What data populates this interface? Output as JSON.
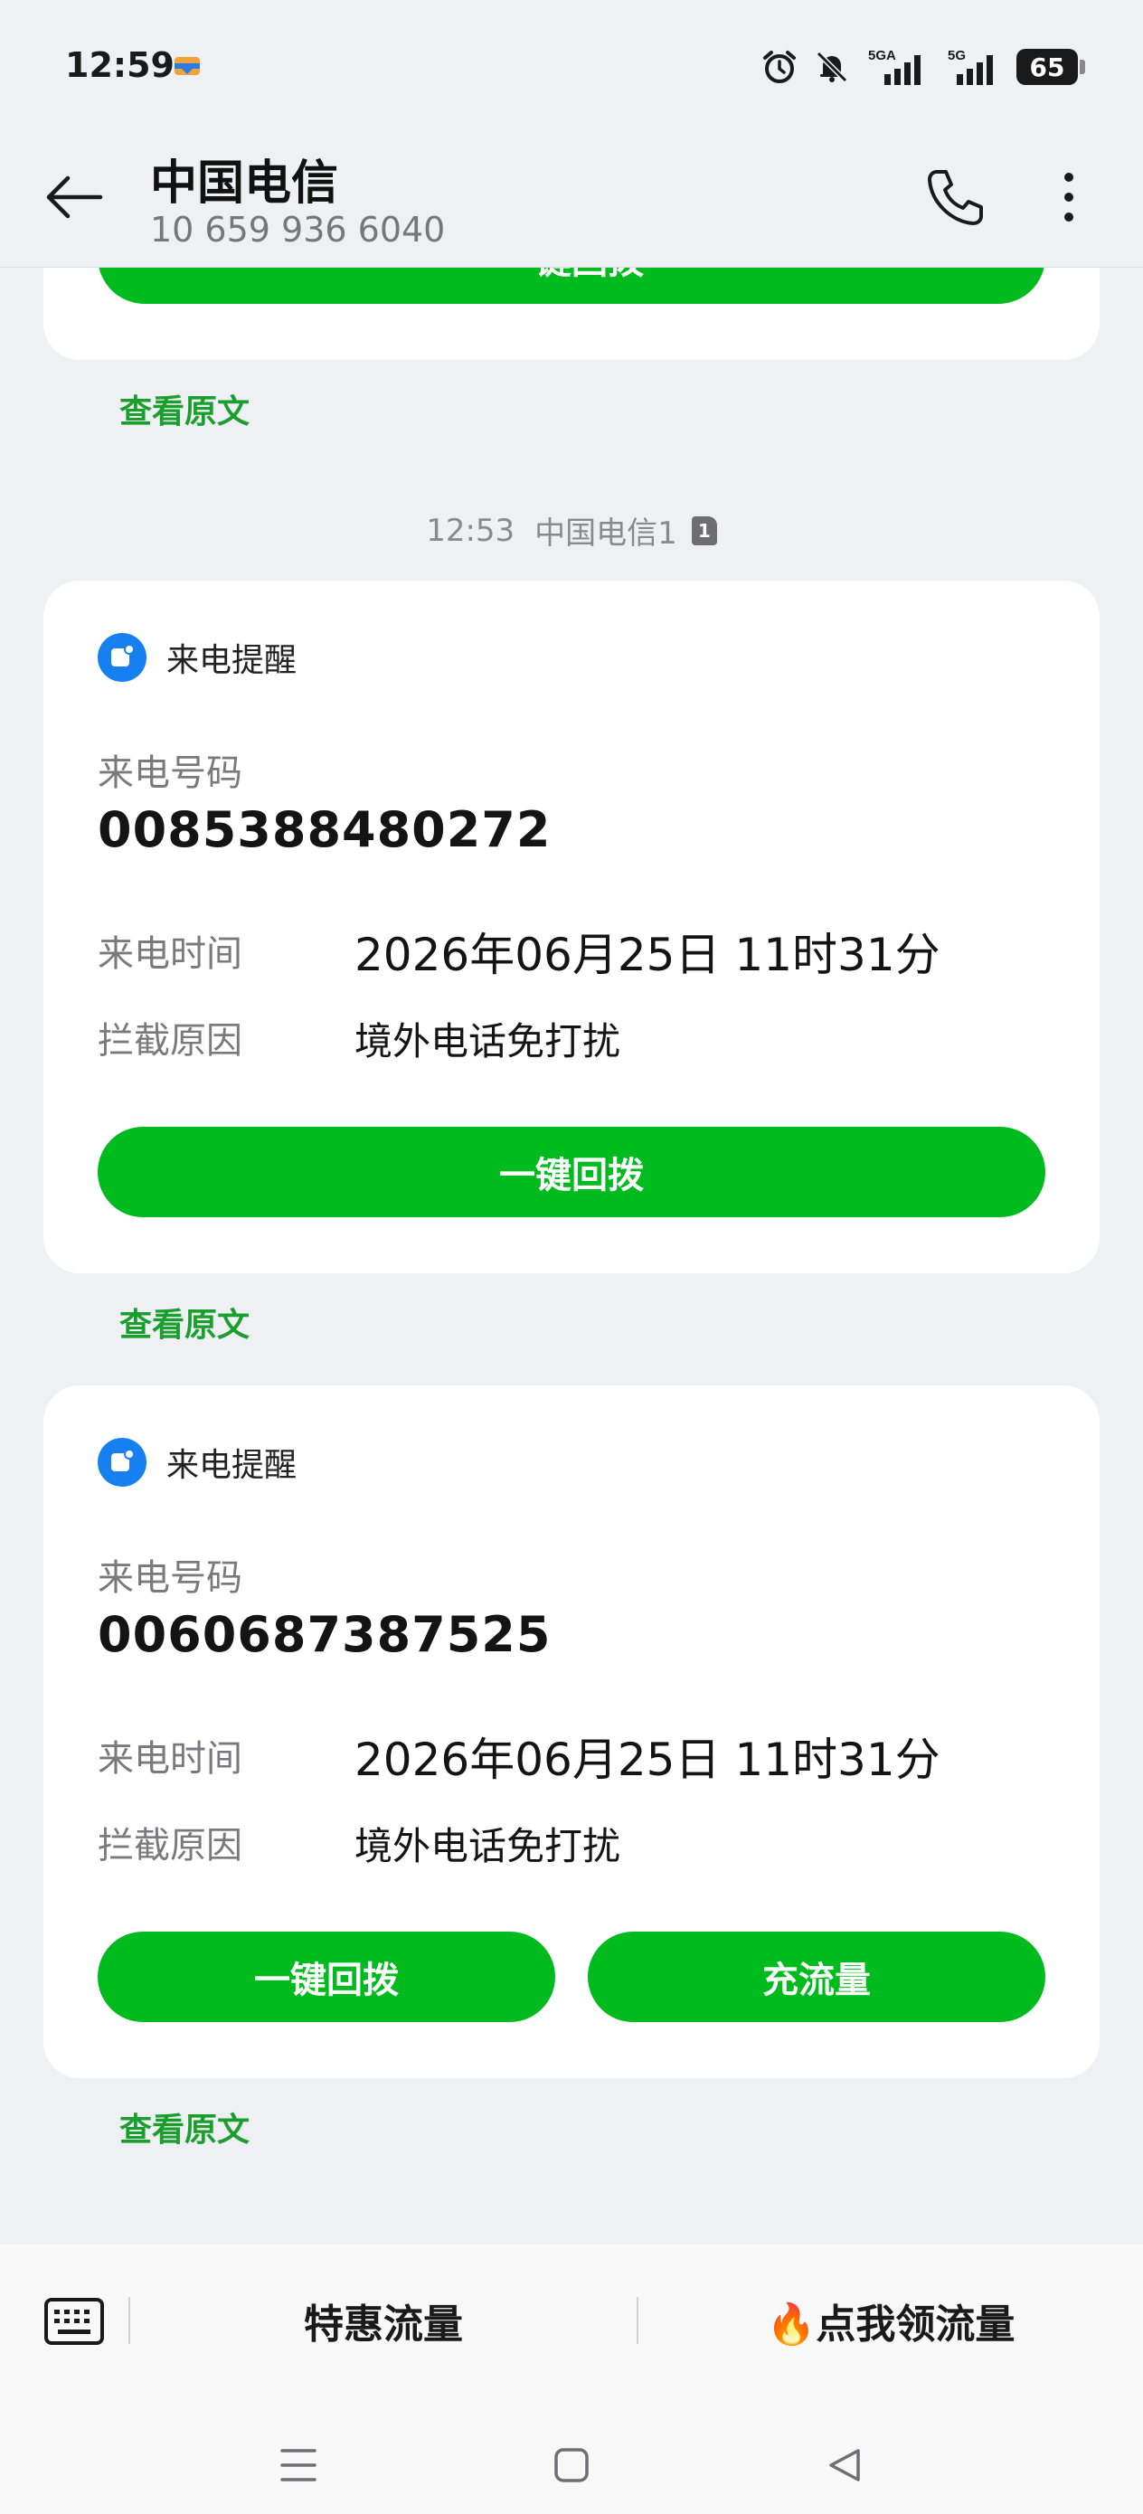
{
  "status_bar": {
    "time": "12:59",
    "signal_1_label": "5GA",
    "signal_2_label": "5G",
    "battery": "65",
    "icons": [
      "alarm-icon",
      "muted-bell-icon",
      "signal-5ga-icon",
      "signal-5g-icon",
      "battery-icon"
    ]
  },
  "header": {
    "title": "中国电信",
    "subtitle": "10 659 936 6040"
  },
  "messages": {
    "partial_card_button": "一键回拨",
    "partial_view_original": "查看原文",
    "timestamp": "12:53",
    "sender": "中国电信1",
    "sim": "1",
    "cards": [
      {
        "head_label": "来电提醒",
        "number_label": "来电号码",
        "number": "0085388480272",
        "time_label": "来电时间",
        "time_value": "2026年06月25日 11时31分",
        "reason_label": "拦截原因",
        "reason_value": "境外电话免打扰",
        "button_1": "一键回拨",
        "view_original": "查看原文"
      },
      {
        "head_label": "来电提醒",
        "number_label": "来电号码",
        "number": "0060687387525",
        "time_label": "来电时间",
        "time_value": "2026年06月25日 11时31分",
        "reason_label": "拦截原因",
        "reason_value": "境外电话免打扰",
        "button_1": "一键回拨",
        "button_2": "充流量",
        "view_original": "查看原文"
      }
    ]
  },
  "bottom_bar": {
    "item_1": "特惠流量",
    "item_2": "🔥点我领流量"
  },
  "colors": {
    "accent_green": "#00bb1d",
    "link_green": "#1a9e2e",
    "icon_blue": "#1780f0",
    "background": "#eff0f3"
  }
}
